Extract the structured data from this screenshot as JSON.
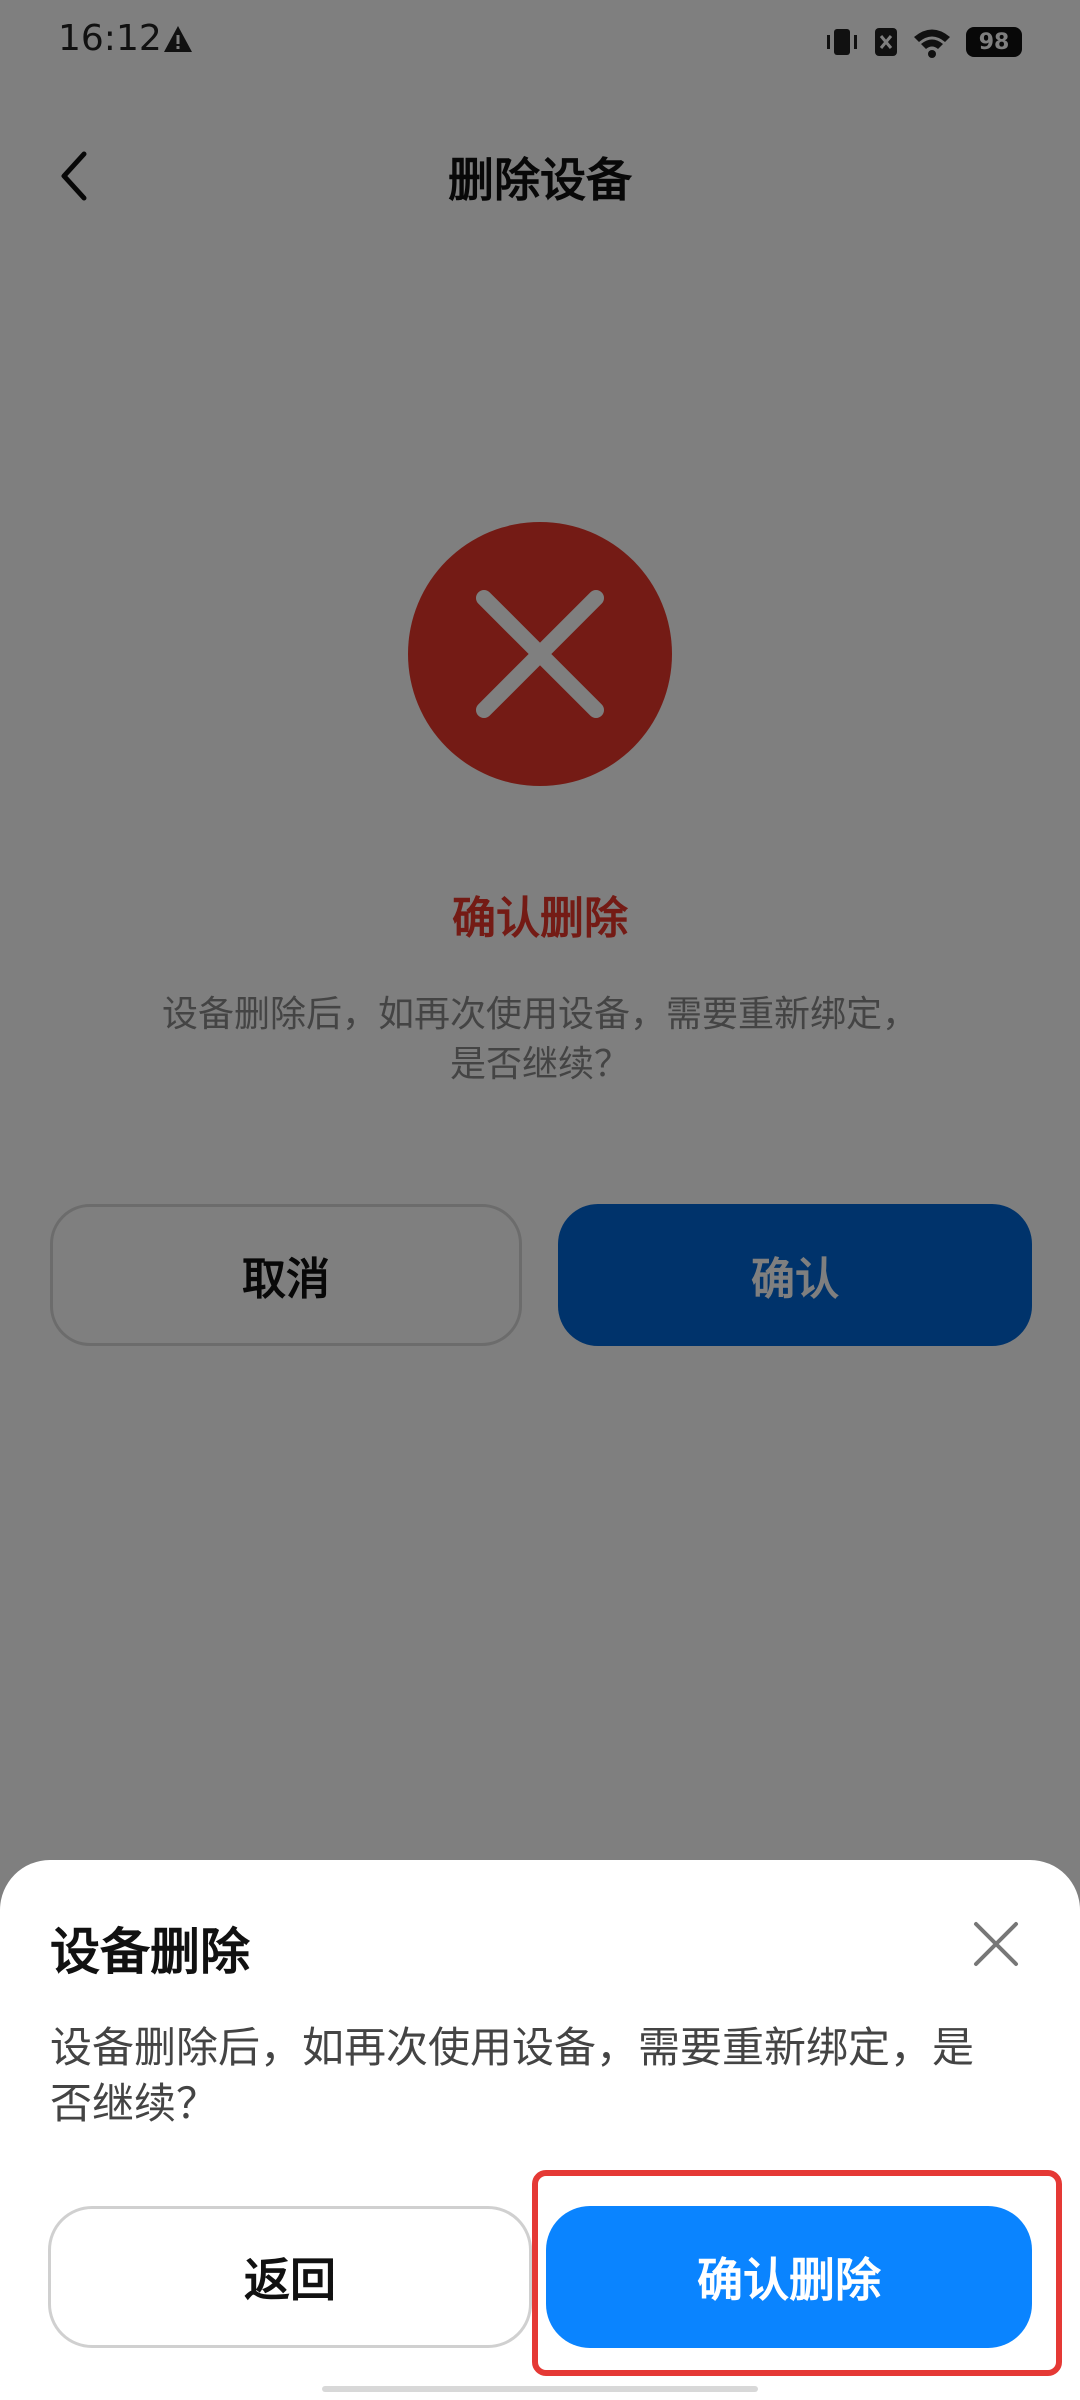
{
  "status_bar": {
    "time": "16:12",
    "battery": "98"
  },
  "header": {
    "title": "删除设备"
  },
  "main": {
    "confirm_title": "确认删除",
    "description": "设备删除后，如再次使用设备，需要重新绑定，是否继续？",
    "cancel_label": "取消",
    "confirm_label": "确认"
  },
  "sheet": {
    "title": "设备删除",
    "description": "设备删除后，如再次使用设备，需要重新绑定，是否继续？",
    "back_label": "返回",
    "confirm_delete_label": "确认删除"
  },
  "colors": {
    "danger": "#E8372A",
    "primary_blue": "#0A84FF",
    "highlight": "#E53935"
  },
  "icons": [
    "warning-icon",
    "vibrate-icon",
    "sim-off-icon",
    "wifi-icon",
    "battery-icon",
    "back-icon",
    "error-x-icon",
    "close-icon"
  ]
}
